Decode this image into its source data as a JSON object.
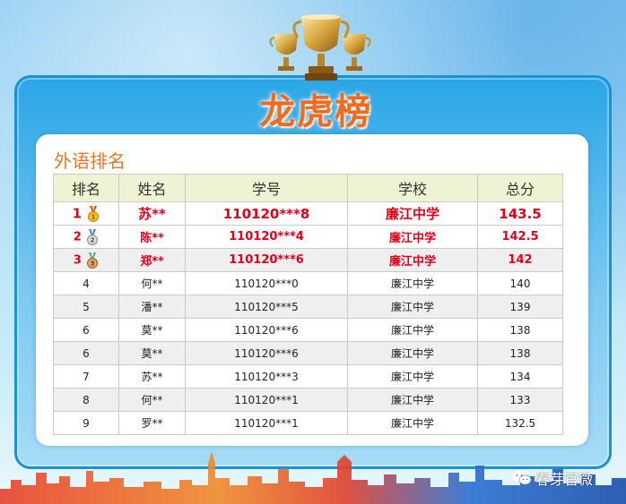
{
  "title": "龙虎榜",
  "section_title": "外语排名",
  "table": {
    "headers": [
      "排名",
      "姓名",
      "学号",
      "学校",
      "总分"
    ],
    "rows": [
      {
        "rank": "1",
        "name": "苏**",
        "id": "110120***8",
        "school": "廉江中学",
        "score": "143.5",
        "medal": "gold-medal"
      },
      {
        "rank": "2",
        "name": "陈**",
        "id": "110120***4",
        "school": "廉江中学",
        "score": "142.5",
        "medal": "silver-medal"
      },
      {
        "rank": "3",
        "name": "郑**",
        "id": "110120***6",
        "school": "廉江中学",
        "score": "142",
        "medal": "bronze-medal"
      },
      {
        "rank": "4",
        "name": "何**",
        "id": "110120***0",
        "school": "廉江中学",
        "score": "140"
      },
      {
        "rank": "5",
        "name": "潘**",
        "id": "110120***5",
        "school": "廉江中学",
        "score": "139"
      },
      {
        "rank": "6",
        "name": "莫**",
        "id": "110120***6",
        "school": "廉江中学",
        "score": "138"
      },
      {
        "rank": "6",
        "name": "莫**",
        "id": "110120***6",
        "school": "廉江中学",
        "score": "138"
      },
      {
        "rank": "7",
        "name": "苏**",
        "id": "110120***3",
        "school": "廉江中学",
        "score": "134"
      },
      {
        "rank": "8",
        "name": "何**",
        "id": "110120***1",
        "school": "廉江中学",
        "score": "133"
      },
      {
        "rank": "9",
        "name": "罗**",
        "id": "110120***1",
        "school": "廉江中学",
        "score": "132.5"
      }
    ]
  },
  "watermark": {
    "label": "春芽官微",
    "icon": "wechat-icon"
  },
  "colors": {
    "accent_red": "#e0001b",
    "title_orange": "#f36a1e",
    "header_bg": "#eef3d3",
    "frame_blue": "#1a93d6"
  }
}
